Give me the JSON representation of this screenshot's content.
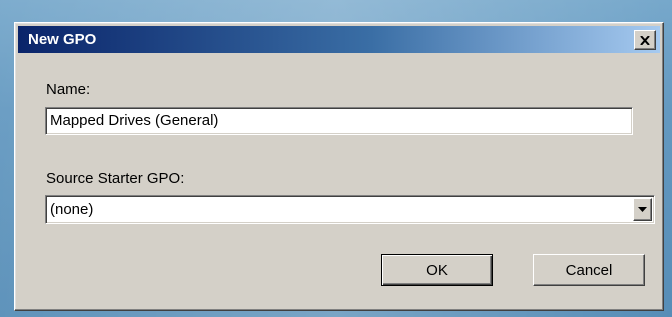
{
  "dialog": {
    "title": "New GPO",
    "close_icon": "close-icon"
  },
  "name_field": {
    "label": "Name:",
    "value": "Mapped Drives (General)"
  },
  "starter_field": {
    "label": "Source Starter GPO:",
    "selected": "(none)",
    "dropdown_icon": "chevron-down-icon"
  },
  "buttons": {
    "ok_label": "OK",
    "cancel_label": "Cancel"
  },
  "colors": {
    "title_gradient_start": "#0a246a",
    "title_gradient_end": "#a6caf0",
    "dialog_face": "#d4d0c8",
    "desktop": "#5b93bd"
  }
}
